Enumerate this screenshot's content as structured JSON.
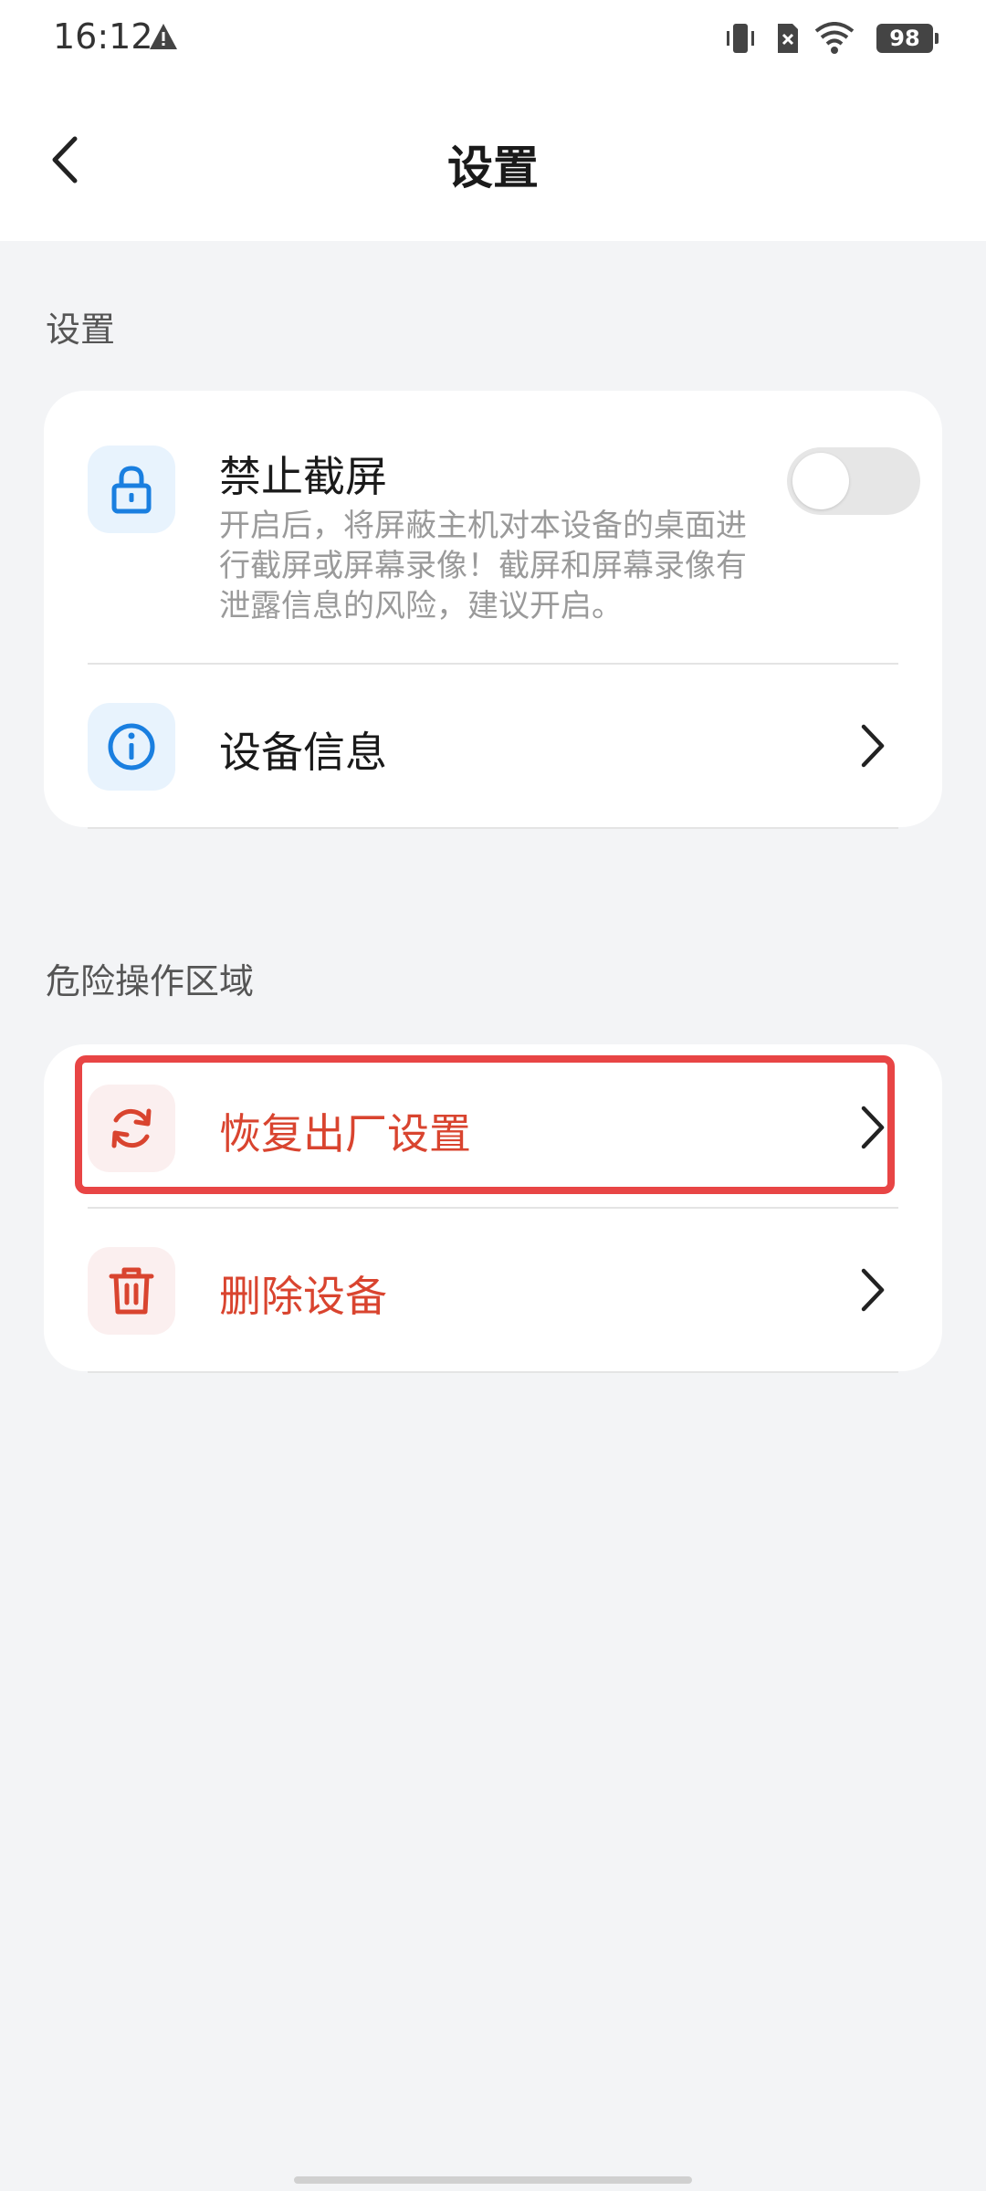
{
  "status_bar": {
    "time": "16:12",
    "battery": "98",
    "icons": [
      "warning-icon",
      "vibrate-icon",
      "no-sim-icon",
      "wifi-icon",
      "battery-icon"
    ]
  },
  "header": {
    "title": "设置",
    "back_icon": "chevron-left-icon"
  },
  "settings_section": {
    "title": "设置",
    "items": [
      {
        "label": "禁止截屏",
        "description": "开启后，将屏蔽主机对本设备的桌面进行截屏或屏幕录像！截屏和屏幕录像有泄露信息的风险，建议开启。",
        "icon": "lock-icon",
        "toggle_on": false
      },
      {
        "label": "设备信息",
        "icon": "info-icon"
      }
    ]
  },
  "danger_section": {
    "title": "危险操作区域",
    "items": [
      {
        "label": "恢复出厂设置",
        "icon": "refresh-icon"
      },
      {
        "label": "删除设备",
        "icon": "trash-icon"
      }
    ]
  },
  "colors": {
    "accent_blue": "#1a7fe0",
    "danger_red": "#d9442f",
    "highlight_red": "#e84545",
    "background": "#f3f4f6"
  }
}
